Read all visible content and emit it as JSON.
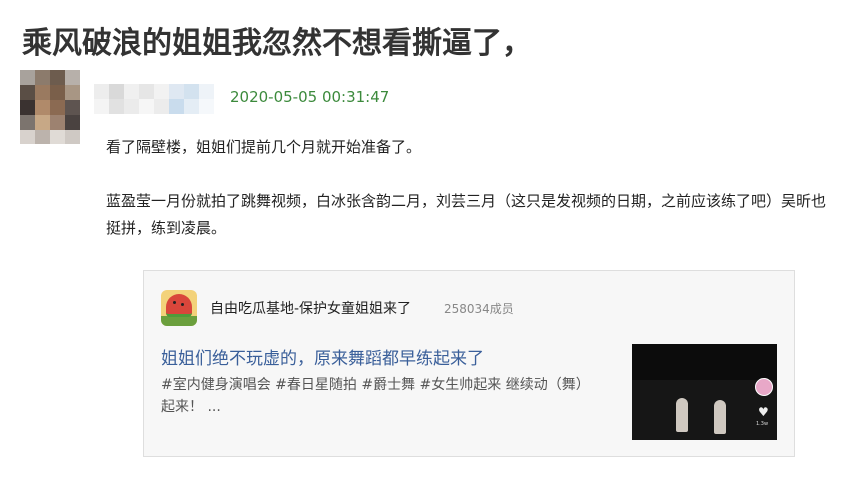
{
  "post": {
    "title": "乘风破浪的姐姐我忽然不想看撕逼了，",
    "author_pixelated": true,
    "timestamp": "2020-05-05 00:31:47",
    "paragraphs": [
      "看了隔壁楼，姐姐们提前几个月就开始准备了。",
      "蓝盈莹一月份就拍了跳舞视频，白冰张含韵二月，刘芸三月（这只是发视频的日期，之前应该练了吧）吴昕也挺拼，练到凌晨。"
    ]
  },
  "card": {
    "group_name": "自由吃瓜基地-保护女童姐姐来了",
    "members": "258034成员",
    "post_title": "姐姐们绝不玩虚的，原来舞蹈都早练起来了",
    "tags": "#室内健身演唱会 #春日星随拍 #爵士舞 #女生帅起来 继续动（舞）起来！ ...",
    "thumbnail_like_count": "1.3w"
  },
  "colors": {
    "timestamp": "#3c8a3c",
    "link": "#3a5f9a",
    "card_bg": "#f7f7f7"
  },
  "icons": [
    "watermelon-group-icon",
    "heart-icon"
  ]
}
